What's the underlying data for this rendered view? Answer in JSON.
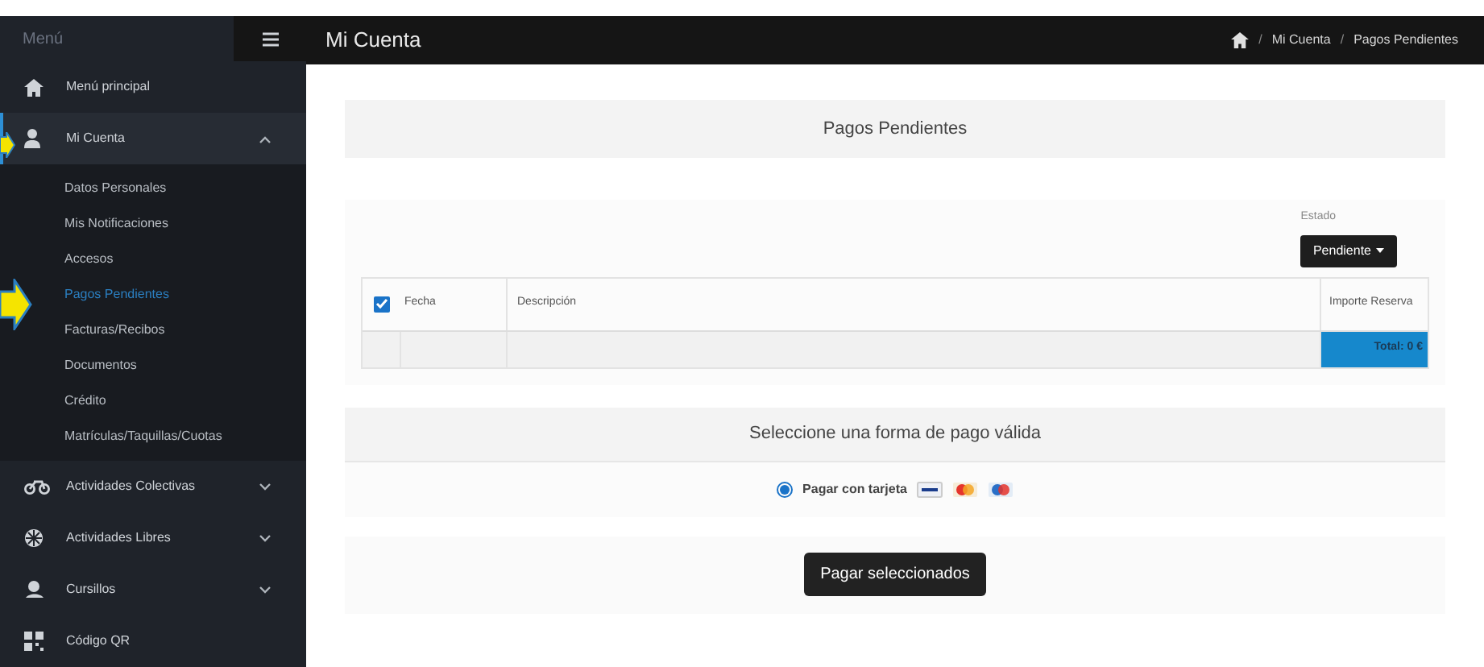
{
  "sidebar": {
    "title": "Menú",
    "items": [
      {
        "label": "Menú principal",
        "kind": "link",
        "selected": false
      },
      {
        "label": "Mi Cuenta",
        "kind": "group",
        "expanded": true,
        "selected": true,
        "children": [
          {
            "label": "Datos Personales",
            "selected": false
          },
          {
            "label": "Mis Notificaciones",
            "selected": false
          },
          {
            "label": "Accesos",
            "selected": false
          },
          {
            "label": "Pagos Pendientes",
            "selected": true
          },
          {
            "label": "Facturas/Recibos",
            "selected": false
          },
          {
            "label": "Documentos",
            "selected": false
          },
          {
            "label": "Crédito",
            "selected": false
          },
          {
            "label": "Matrículas/Taquillas/Cuotas",
            "selected": false
          }
        ]
      },
      {
        "label": "Actividades Colectivas",
        "kind": "group",
        "expanded": false,
        "selected": false
      },
      {
        "label": "Actividades Libres",
        "kind": "group",
        "expanded": false,
        "selected": false
      },
      {
        "label": "Cursillos",
        "kind": "group",
        "expanded": false,
        "selected": false
      },
      {
        "label": "Código QR",
        "kind": "link",
        "selected": false
      }
    ]
  },
  "header": {
    "title": "Mi Cuenta",
    "breadcrumb": [
      {
        "kind": "separator",
        "text": "/"
      },
      {
        "kind": "link",
        "text": "Mi Cuenta"
      },
      {
        "kind": "separator",
        "text": "/"
      },
      {
        "kind": "link",
        "text": "Pagos Pendientes"
      }
    ]
  },
  "main": {
    "title": "Pagos Pendientes",
    "filter": {
      "label": "Estado",
      "value": "Pendiente"
    },
    "table": {
      "select_all": {
        "checked": true
      },
      "columns": [
        "Fecha",
        "Descripción",
        "Importe Reserva"
      ],
      "total": "Total: 0 €"
    },
    "payment": {
      "title": "Seleccione una forma de pago válida",
      "options": [
        {
          "label": "Pagar con tarjeta",
          "selected": true
        }
      ]
    },
    "submit": "Pagar seleccionados"
  }
}
